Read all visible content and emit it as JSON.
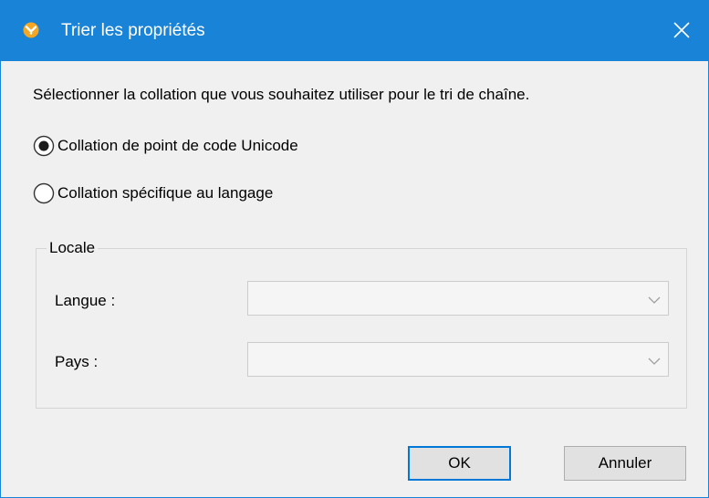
{
  "window": {
    "title": "Trier les propriétés",
    "icon": "altova-app-icon",
    "close_icon": "close-icon"
  },
  "colors": {
    "titlebar": "#1883d7",
    "dialog_bg": "#f0f0f0",
    "default_button_border": "#0078d7"
  },
  "instruction": "Sélectionner la collation que vous souhaitez utiliser pour le tri de chaîne.",
  "options": [
    {
      "label": "Collation de point de code Unicode",
      "selected": true
    },
    {
      "label": "Collation spécifique au langage",
      "selected": false
    }
  ],
  "locale": {
    "group_label": "Locale",
    "language": {
      "label": "Langue :",
      "value": "",
      "enabled": false
    },
    "country": {
      "label": "Pays :",
      "value": "",
      "enabled": false
    }
  },
  "buttons": {
    "ok": "OK",
    "cancel": "Annuler"
  }
}
